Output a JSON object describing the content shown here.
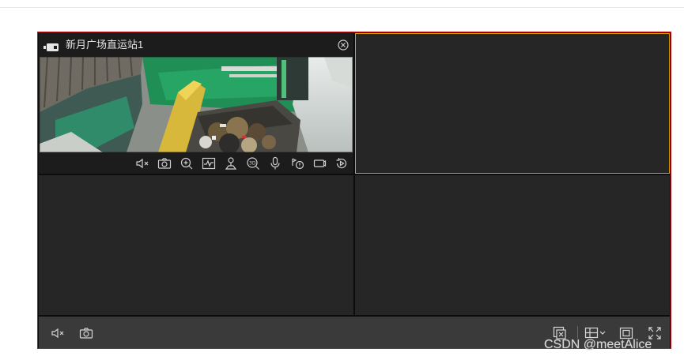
{
  "camera": {
    "title": "新月广场直运站1"
  },
  "cell_toolbar": {
    "icons": [
      "mute-icon",
      "snapshot-icon",
      "zoom-in-icon",
      "stream-icon",
      "ptz-icon",
      "3d-zoom-icon",
      "microphone-icon",
      "alarm-icon",
      "record-icon",
      "playback-icon"
    ]
  },
  "bottom_toolbar": {
    "left_icons": [
      "mute-icon",
      "snapshot-icon"
    ],
    "right_icons": [
      "close-all-icon",
      "layout-grid-icon",
      "fit-window-icon",
      "fullscreen-icon"
    ]
  },
  "selection_color": "#d9a000",
  "border_color": "#c8141e",
  "watermark": "CSDN @meetAlice"
}
